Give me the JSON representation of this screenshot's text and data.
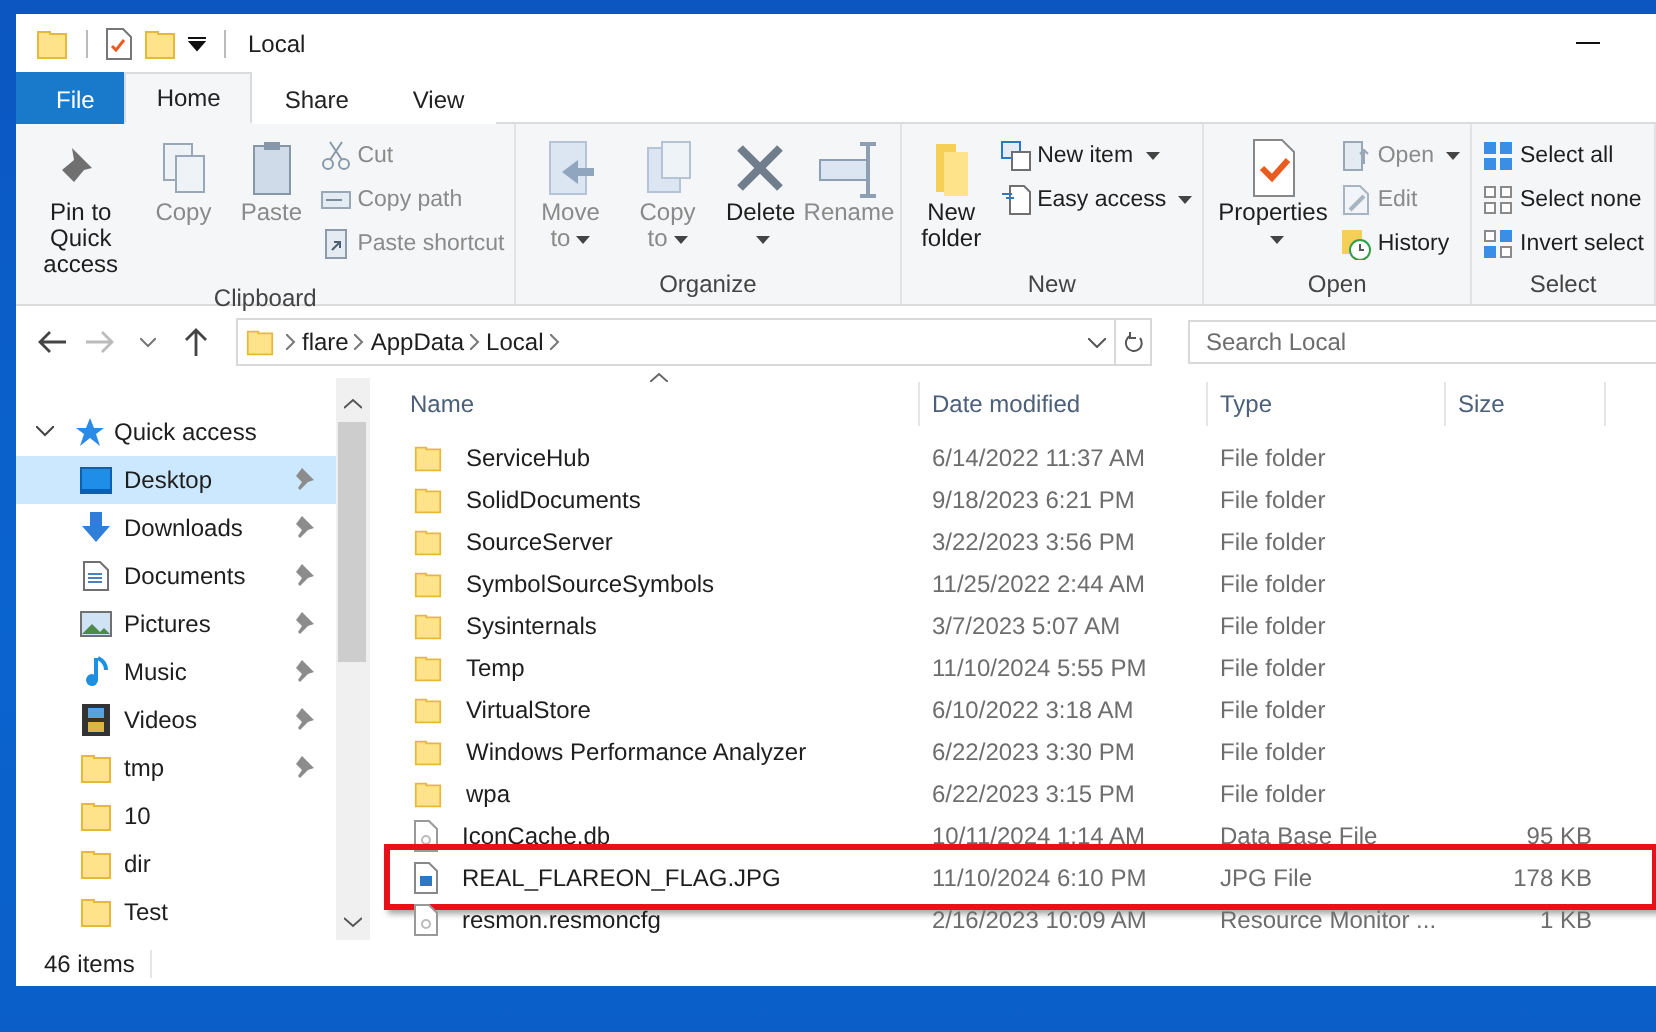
{
  "title_bar": {
    "title": "Local"
  },
  "ribbon": {
    "tabs": [
      {
        "label": "File",
        "kind": "file",
        "selected": false
      },
      {
        "label": "Home",
        "kind": "tab",
        "selected": true
      },
      {
        "label": "Share",
        "kind": "tab",
        "selected": false
      },
      {
        "label": "View",
        "kind": "tab",
        "selected": false
      }
    ],
    "groups": [
      {
        "label": "Clipboard",
        "large": [
          {
            "label": "Pin to Quick access",
            "disabled": false,
            "menu": false
          },
          {
            "label": "Copy",
            "disabled": true,
            "menu": false
          },
          {
            "label": "Paste",
            "disabled": true,
            "menu": false
          }
        ],
        "small": [
          {
            "label": "Cut",
            "disabled": true,
            "menu": false
          },
          {
            "label": "Copy path",
            "disabled": true,
            "menu": false
          },
          {
            "label": "Paste shortcut",
            "disabled": true,
            "menu": false
          }
        ]
      },
      {
        "label": "Organize",
        "large": [
          {
            "label": "Move to",
            "disabled": true,
            "menu": true
          },
          {
            "label": "Copy to",
            "disabled": true,
            "menu": true
          },
          {
            "label": "Delete",
            "disabled": false,
            "menu": true
          },
          {
            "label": "Rename",
            "disabled": true,
            "menu": false
          }
        ]
      },
      {
        "label": "New",
        "large": [
          {
            "label": "New folder",
            "disabled": false,
            "menu": false
          }
        ],
        "small": [
          {
            "label": "New item",
            "disabled": false,
            "menu": true
          },
          {
            "label": "Easy access",
            "disabled": false,
            "menu": true
          }
        ]
      },
      {
        "label": "Open",
        "large": [
          {
            "label": "Properties",
            "disabled": false,
            "menu": true
          }
        ],
        "small": [
          {
            "label": "Open",
            "disabled": true,
            "menu": true
          },
          {
            "label": "Edit",
            "disabled": true,
            "menu": false
          },
          {
            "label": "History",
            "disabled": false,
            "menu": false
          }
        ]
      },
      {
        "label": "Select",
        "small": [
          {
            "label": "Select all",
            "disabled": false,
            "menu": false
          },
          {
            "label": "Select none",
            "disabled": false,
            "menu": false
          },
          {
            "label": "Invert select",
            "disabled": false,
            "menu": false
          }
        ]
      }
    ]
  },
  "address": {
    "path": [
      "flare",
      "AppData",
      "Local"
    ],
    "search_placeholder": "Search Local"
  },
  "navigation": {
    "quick_access": {
      "label": "Quick access",
      "expanded": true
    },
    "items": [
      {
        "label": "Desktop",
        "pinned": true,
        "selected": true
      },
      {
        "label": "Downloads",
        "pinned": true,
        "selected": false
      },
      {
        "label": "Documents",
        "pinned": true,
        "selected": false
      },
      {
        "label": "Pictures",
        "pinned": true,
        "selected": false
      },
      {
        "label": "Music",
        "pinned": true,
        "selected": false
      },
      {
        "label": "Videos",
        "pinned": true,
        "selected": false
      },
      {
        "label": "tmp",
        "pinned": true,
        "selected": false
      },
      {
        "label": "10",
        "pinned": false,
        "selected": false
      },
      {
        "label": "dir",
        "pinned": false,
        "selected": false
      },
      {
        "label": "Test",
        "pinned": false,
        "selected": false
      }
    ]
  },
  "files": {
    "columns": [
      "Name",
      "Date modified",
      "Type",
      "Size"
    ],
    "rows": [
      {
        "kind": "folder",
        "name": "ServiceHub",
        "date": "6/14/2022 11:37 AM",
        "type": "File folder",
        "highlighted": false
      },
      {
        "kind": "folder",
        "name": "SolidDocuments",
        "date": "9/18/2023 6:21 PM",
        "type": "File folder",
        "highlighted": false
      },
      {
        "kind": "folder",
        "name": "SourceServer",
        "date": "3/22/2023 3:56 PM",
        "type": "File folder",
        "highlighted": false
      },
      {
        "kind": "folder",
        "name": "SymbolSourceSymbols",
        "date": "11/25/2022 2:44 AM",
        "type": "File folder",
        "highlighted": false
      },
      {
        "kind": "folder",
        "name": "Sysinternals",
        "date": "3/7/2023 5:07 AM",
        "type": "File folder",
        "highlighted": false
      },
      {
        "kind": "folder",
        "name": "Temp",
        "date": "11/10/2024 5:55 PM",
        "type": "File folder",
        "highlighted": false
      },
      {
        "kind": "folder",
        "name": "VirtualStore",
        "date": "6/10/2022 3:18 AM",
        "type": "File folder",
        "highlighted": false
      },
      {
        "kind": "folder",
        "name": "Windows Performance Analyzer",
        "date": "6/22/2023 3:30 PM",
        "type": "File folder",
        "highlighted": false
      },
      {
        "kind": "folder",
        "name": "wpa",
        "date": "6/22/2023 3:15 PM",
        "type": "File folder",
        "highlighted": false
      },
      {
        "kind": "file",
        "name": "IconCache.db",
        "date": "10/11/2024 1:14 AM",
        "type": "Data Base File",
        "size": "95 KB",
        "highlighted": false
      },
      {
        "kind": "image",
        "name": "REAL_FLAREON_FLAG.JPG",
        "date": "11/10/2024 6:10 PM",
        "type": "JPG File",
        "size": "178 KB",
        "highlighted": true
      },
      {
        "kind": "file",
        "name": "resmon.resmoncfg",
        "date": "2/16/2023 10:09 AM",
        "type": "Resource Monitor ...",
        "size": "1 KB",
        "highlighted": false
      }
    ]
  },
  "status_bar": {
    "item_count": "46 items"
  }
}
